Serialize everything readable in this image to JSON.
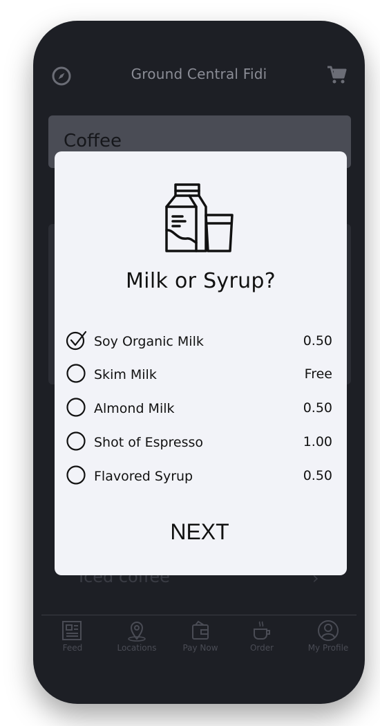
{
  "header": {
    "title": "Ground Central Fidi",
    "left_icon": "compass-icon",
    "right_icon": "cart-icon"
  },
  "background": {
    "category_card": "Coffee",
    "list_item": "Iced coffee"
  },
  "modal": {
    "icon": "milk-carton-and-glass-icon",
    "title": "Milk or Syrup?",
    "options": [
      {
        "label": "Soy Organic Milk",
        "price": "0.50",
        "checked": true
      },
      {
        "label": "Skim Milk",
        "price": "Free",
        "checked": false
      },
      {
        "label": "Almond Milk",
        "price": "0.50",
        "checked": false
      },
      {
        "label": "Shot of Espresso",
        "price": "1.00",
        "checked": false
      },
      {
        "label": "Flavored Syrup",
        "price": "0.50",
        "checked": false
      }
    ],
    "next_label": "NEXT"
  },
  "tabbar": {
    "items": [
      {
        "label": "Feed",
        "icon": "newspaper-icon",
        "active": true
      },
      {
        "label": "Locations",
        "icon": "map-pin-icon",
        "active": false
      },
      {
        "label": "Pay Now",
        "icon": "wallet-icon",
        "active": false
      },
      {
        "label": "Order",
        "icon": "coffee-cup-icon",
        "active": false
      },
      {
        "label": "My Profile",
        "icon": "user-icon",
        "active": false
      }
    ]
  },
  "colors": {
    "screen_bg": "#1d1f25",
    "modal_bg": "#f2f3f8",
    "dim_text": "#8b8d96"
  }
}
